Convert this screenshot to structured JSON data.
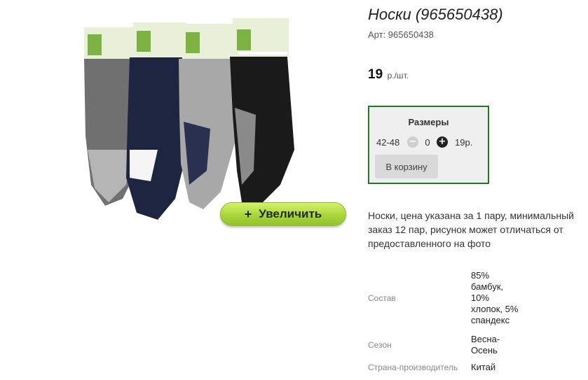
{
  "product": {
    "title": "Носки (965650438)",
    "article": "Арт: 965650438",
    "price": "19",
    "price_unit": "р./шт.",
    "zoom_label": "Увеличить",
    "description": "Носки, цена указана за 1 пару, минимальный заказ 12 пар, рисунок может отличаться от предоставленного на фото"
  },
  "sizes": {
    "title": "Размеры",
    "rows": [
      {
        "size": "42-48",
        "minus": "−",
        "qty": "0",
        "plus": "+",
        "price": "19р."
      }
    ],
    "cart_label": "В корзину"
  },
  "specs": [
    {
      "name": "Состав",
      "value": "85% бамбук, 10% хлопок, 5% спандекс"
    },
    {
      "name": "Сезон",
      "value": "Весна-Осень"
    },
    {
      "name": "Страна-производитель",
      "value": "Китай"
    }
  ],
  "colors": {
    "sizes_border": "#1f7d1f",
    "zoom_button": "#a9d63a"
  },
  "icons": {
    "zoom": "plus-icon",
    "decrease": "minus-circle-icon",
    "increase": "plus-circle-icon"
  }
}
